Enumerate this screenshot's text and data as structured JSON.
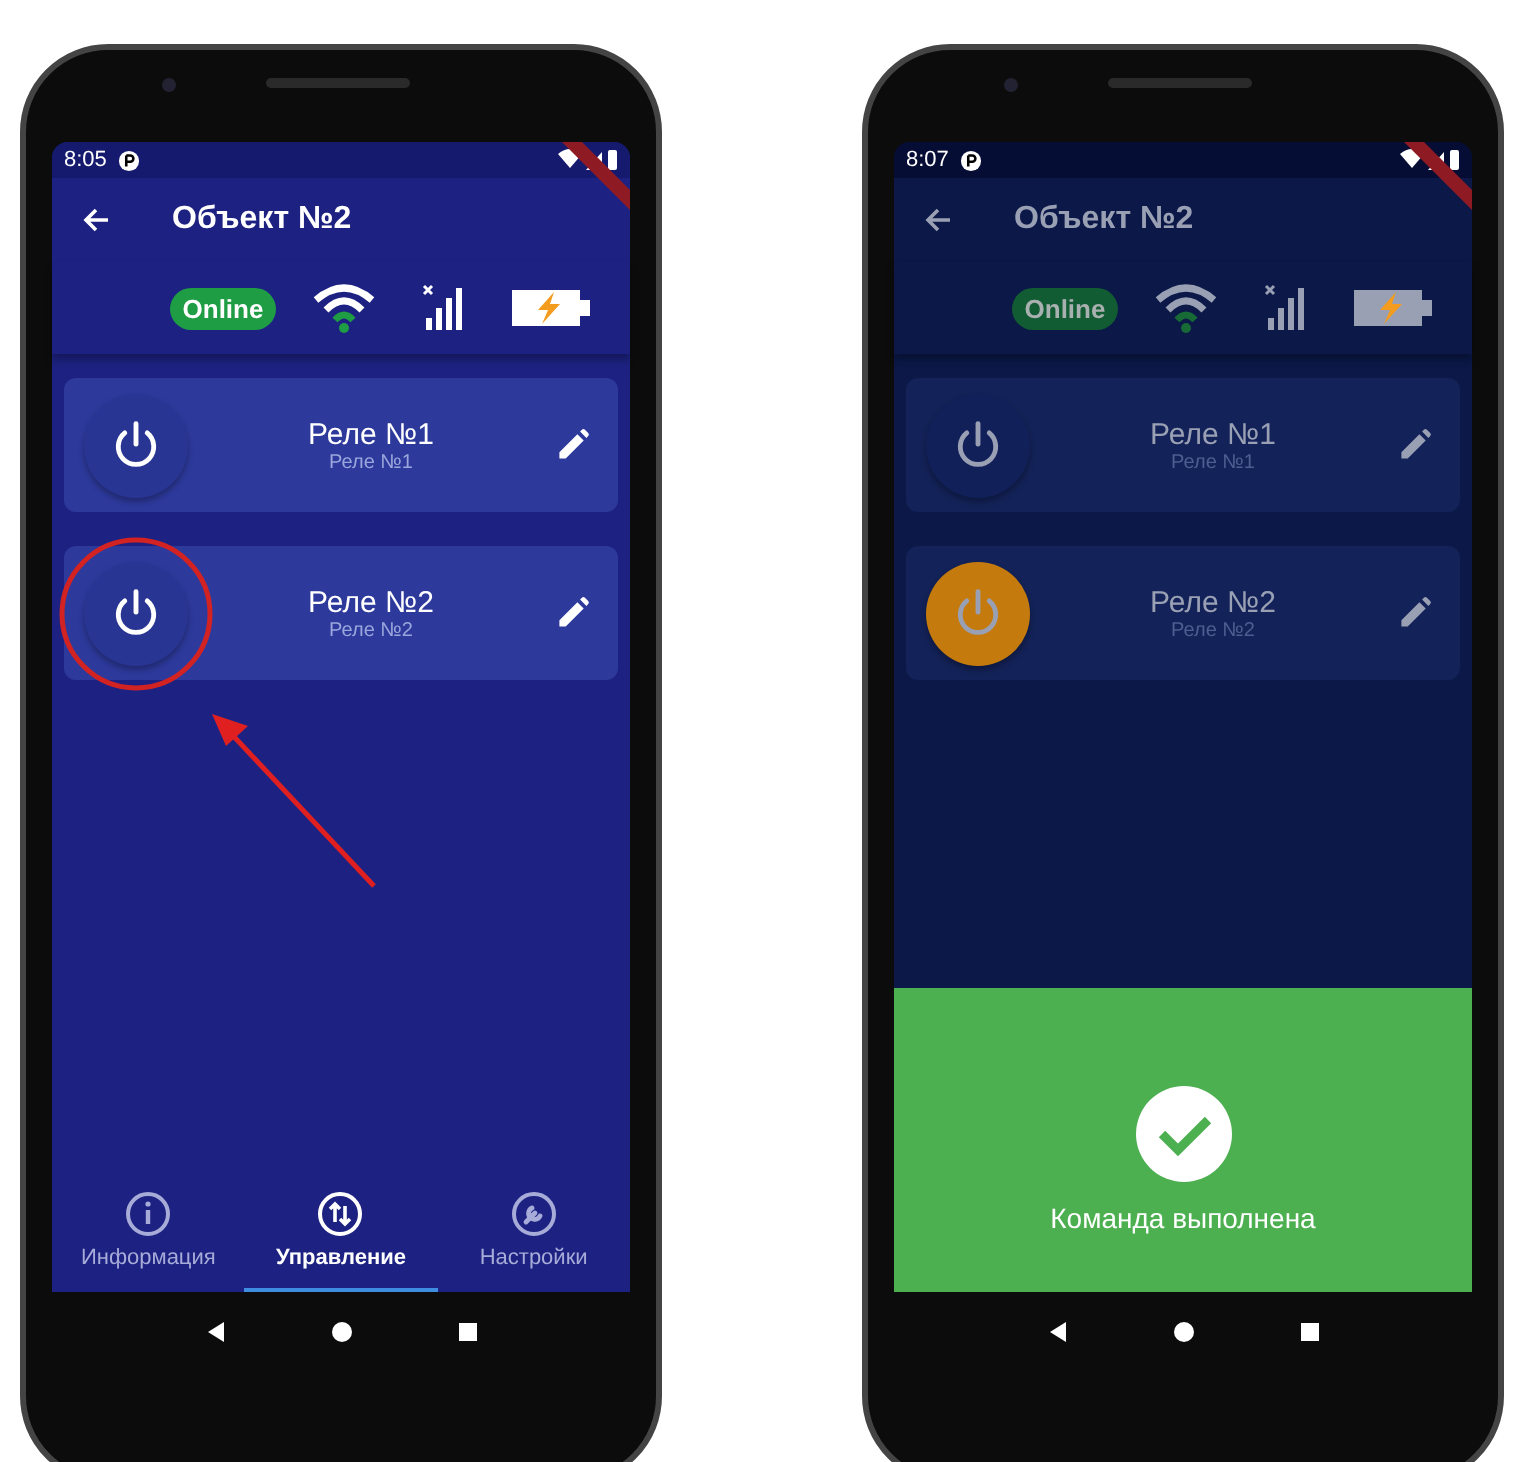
{
  "phones": [
    {
      "dimmed": false,
      "status_bar": {
        "time": "8:05"
      },
      "app_bar": {
        "title": "Объект №2"
      },
      "connection": {
        "badge": "Online"
      },
      "relays": [
        {
          "name": "Реле №1",
          "subtitle": "Реле №1",
          "on": false,
          "annotated": false
        },
        {
          "name": "Реле №2",
          "subtitle": "Реле №2",
          "on": false,
          "annotated": true
        }
      ],
      "bottom_nav": [
        {
          "kind": "info",
          "label": "Информация",
          "selected": false
        },
        {
          "kind": "control",
          "label": "Управление",
          "selected": true
        },
        {
          "kind": "settings",
          "label": "Настройки",
          "selected": false
        }
      ]
    },
    {
      "dimmed": true,
      "status_bar": {
        "time": "8:07"
      },
      "app_bar": {
        "title": "Объект №2"
      },
      "connection": {
        "badge": "Online"
      },
      "relays": [
        {
          "name": "Реле №1",
          "subtitle": "Реле №1",
          "on": false,
          "annotated": false
        },
        {
          "name": "Реле №2",
          "subtitle": "Реле №2",
          "on": true,
          "annotated": false
        }
      ],
      "snackbar": {
        "message": "Команда выполнена"
      }
    }
  ]
}
